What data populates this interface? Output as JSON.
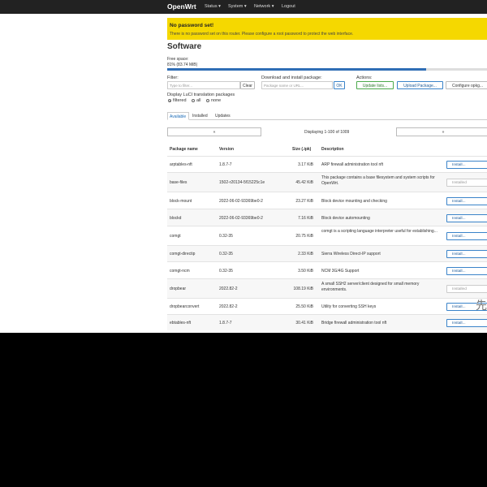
{
  "header": {
    "brand": "OpenWrt",
    "menu": [
      "Status ▾",
      "System ▾",
      "Network ▾",
      "Logout"
    ]
  },
  "alert": {
    "title": "No password set!",
    "message": "There is no password set on this router. Please configure a root password to protect the web interface."
  },
  "page": {
    "title": "Software"
  },
  "free_space": {
    "label": "Free space:",
    "value": "81% (83.74 MiB)",
    "percent": 81,
    "bar_color": "#2f6db5"
  },
  "filter": {
    "label": "Filter:",
    "placeholder": "Type to filter...",
    "clear": "Clear"
  },
  "download": {
    "label": "Download and install package:",
    "placeholder": "Package name or URL...",
    "ok": "OK"
  },
  "actions": {
    "label": "Actions:",
    "update_lists": "Update lists...",
    "upload_package": "Upload Package...",
    "configure": "Configure opkg..."
  },
  "translation": {
    "label": "Display LuCI translation packages",
    "options": [
      "filtered",
      "all",
      "none"
    ],
    "selected": "filtered"
  },
  "tabs": [
    "Available",
    "Installed",
    "Updates"
  ],
  "pager": {
    "prev": "«",
    "next": "»",
    "text": "Displaying 1-100 of 1009"
  },
  "table": {
    "headers": [
      "Package name",
      "Version",
      "Size (.ipk)",
      "Description"
    ],
    "rows": [
      {
        "name": "arptables-nft",
        "version": "1.8.7-7",
        "size": "3.17 KiB",
        "desc": "ARP firewall administration tool nft",
        "action": "Install..."
      },
      {
        "name": "base-files",
        "version": "1502-r20134-5f15225c1e",
        "size": "45.42 KiB",
        "desc": "This package contains a base filesystem and system scripts for OpenWrt.",
        "action": "Installed"
      },
      {
        "name": "block-mount",
        "version": "2022-06-02-93369be0-2",
        "size": "23.27 KiB",
        "desc": "Block device mounting and checking",
        "action": "Install..."
      },
      {
        "name": "blockd",
        "version": "2022-06-02-93369be0-2",
        "size": "7.16 KiB",
        "desc": "Block device automounting",
        "action": "Install..."
      },
      {
        "name": "comgt",
        "version": "0.32-35",
        "size": "20.75 KiB",
        "desc": "comgt is a scripting language interpreter useful for establishing...",
        "action": "Install..."
      },
      {
        "name": "comgt-directip",
        "version": "0.32-35",
        "size": "2.33 KiB",
        "desc": "Sierra Wireless Direct-IP support",
        "action": "Install..."
      },
      {
        "name": "comgt-ncm",
        "version": "0.32-35",
        "size": "3.50 KiB",
        "desc": "NCM 3G/4G Support",
        "action": "Install..."
      },
      {
        "name": "dropbear",
        "version": "2022.82-2",
        "size": "108.19 KiB",
        "desc": "A small SSH2 server/client designed for small memory environments.",
        "action": "Installed"
      },
      {
        "name": "dropbearconvert",
        "version": "2022.82-2",
        "size": "25.50 KiB",
        "desc": "Utility for converting SSH keys",
        "action": "Install..."
      },
      {
        "name": "ebtables-nft",
        "version": "1.8.7-7",
        "size": "30.41 KiB",
        "desc": "Bridge firewall administration tool nft",
        "action": "Install..."
      }
    ]
  },
  "corner_glyph": "先"
}
